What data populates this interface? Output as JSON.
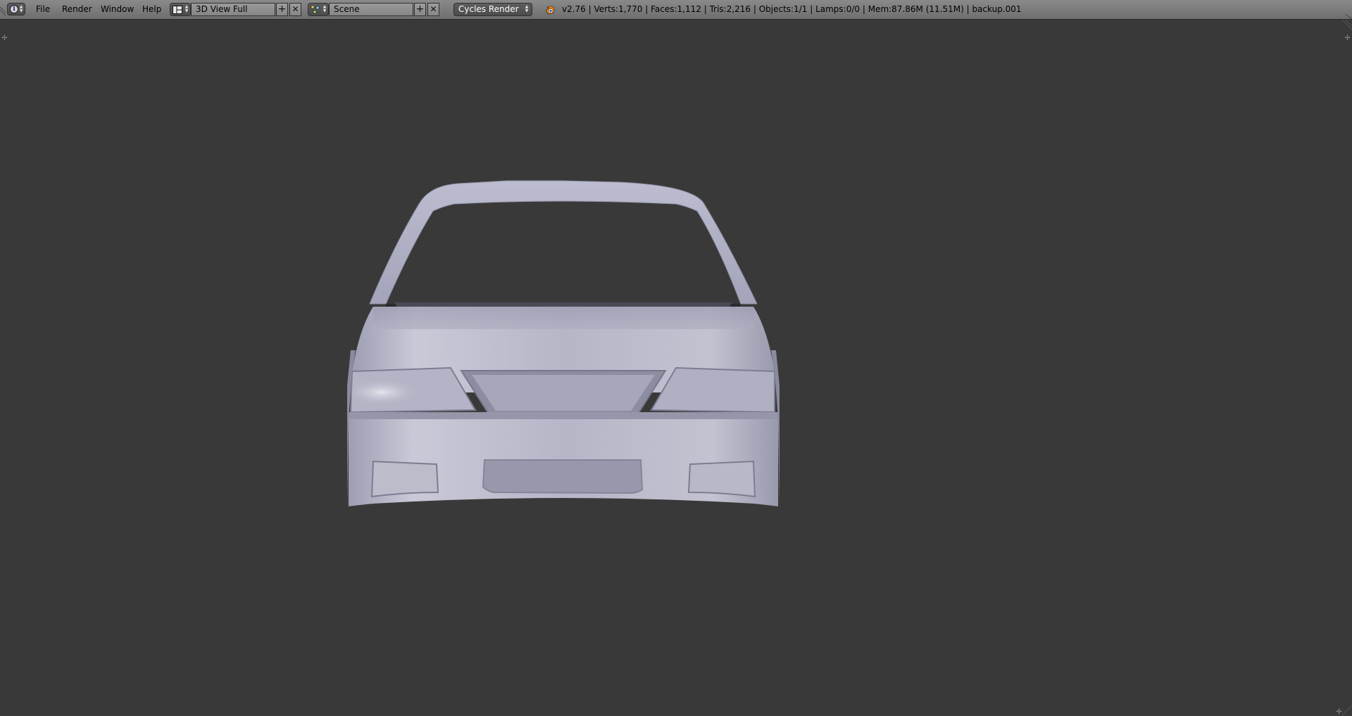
{
  "header": {
    "editor_type_icon": "info-icon",
    "menus": [
      "File",
      "Render",
      "Window",
      "Help"
    ],
    "screen_layout": {
      "icon": "screen-layout-icon",
      "value": "3D View Full"
    },
    "scene": {
      "icon": "scene-icon",
      "value": "Scene"
    },
    "render_engine": "Cycles Render",
    "stats": "v2.76 | Verts:1,770 | Faces:1,112 | Tris:2,216 | Objects:1/1 | Lamps:0/0 | Mem:87.86M (11.51M) | backup.001"
  },
  "viewport": {
    "background": "#393939",
    "model_color": "#b7b7c9",
    "object": "car-front-mesh"
  }
}
